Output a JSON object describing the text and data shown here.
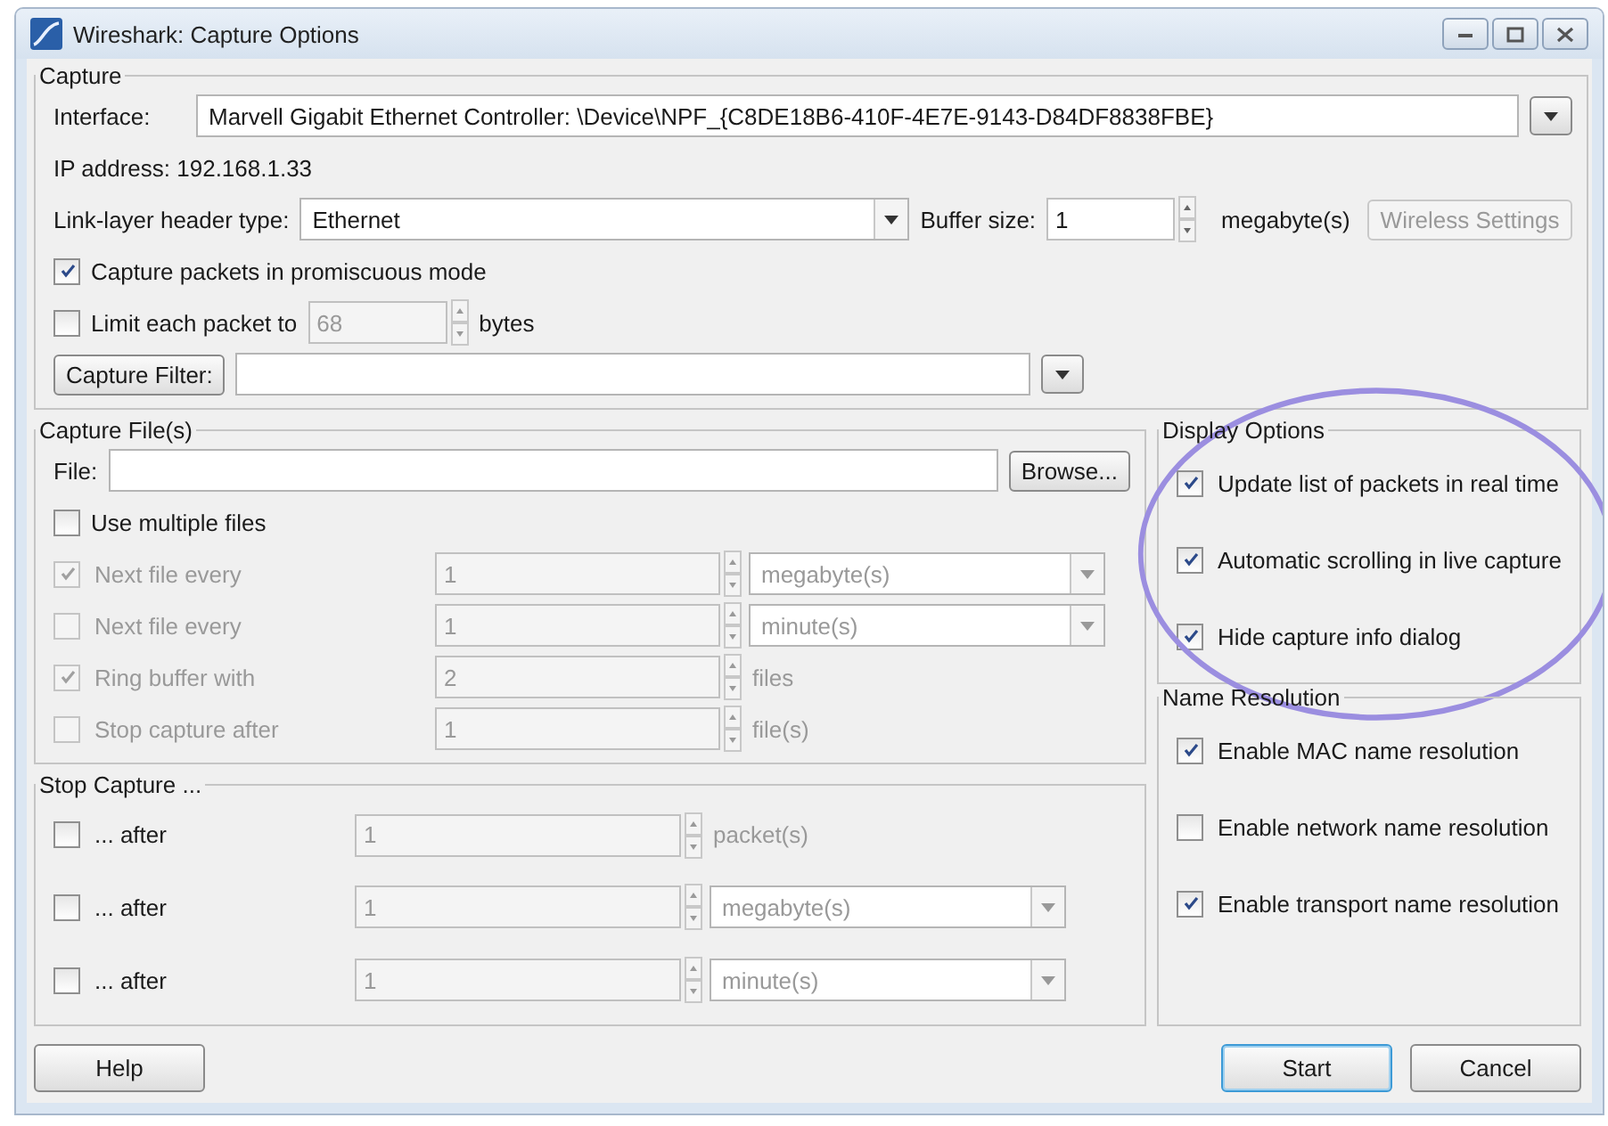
{
  "window": {
    "title": "Wireshark: Capture Options"
  },
  "capture": {
    "title": "Capture",
    "interface": {
      "label": "Interface:",
      "value": "Marvell Gigabit Ethernet Controller: \\Device\\NPF_{C8DE18B6-410F-4E7E-9143-D84DF8838FBE}"
    },
    "ip_address": "IP address: 192.168.1.33",
    "link_layer": {
      "label": "Link-layer header type:",
      "value": "Ethernet"
    },
    "buffer_size": {
      "label": "Buffer size:",
      "value": "1",
      "unit": "megabyte(s)"
    },
    "wireless_button": {
      "label": "Wireless Settings",
      "disabled": true
    },
    "promiscuous": {
      "label": "Capture packets in promiscuous mode",
      "checked": true
    },
    "limit": {
      "label": "Limit each packet to",
      "checked": false,
      "value": "68",
      "unit": "bytes",
      "disabled": true
    },
    "filter": {
      "label": "Capture Filter:"
    }
  },
  "capture_files": {
    "title": "Capture File(s)",
    "file_label": "File:",
    "browse": "Browse...",
    "multiple": {
      "label": "Use multiple files",
      "checked": false
    },
    "rows": [
      {
        "label": "Next file every",
        "checked": true,
        "disabled": true,
        "value": "1",
        "kind": "combo",
        "unit": "megabyte(s)"
      },
      {
        "label": "Next file every",
        "checked": false,
        "disabled": true,
        "value": "1",
        "kind": "combo",
        "unit": "minute(s)"
      },
      {
        "label": "Ring buffer with",
        "checked": true,
        "disabled": true,
        "value": "2",
        "kind": "text",
        "unit": "files"
      },
      {
        "label": "Stop capture after",
        "checked": false,
        "disabled": true,
        "value": "1",
        "kind": "text",
        "unit": "file(s)"
      }
    ]
  },
  "stop_capture": {
    "title": "Stop Capture ...",
    "rows": [
      {
        "label": "... after",
        "checked": false,
        "disabled": false,
        "value": "1",
        "kind": "text",
        "unit": "packet(s)"
      },
      {
        "label": "... after",
        "checked": false,
        "disabled": false,
        "value": "1",
        "kind": "combo",
        "unit": "megabyte(s)"
      },
      {
        "label": "... after",
        "checked": false,
        "disabled": false,
        "value": "1",
        "kind": "combo",
        "unit": "minute(s)"
      }
    ]
  },
  "display_options": {
    "title": "Display Options",
    "highlight": {
      "kind": "ellipse"
    },
    "items": [
      {
        "label": "Update list of packets in real time",
        "checked": true
      },
      {
        "label": "Automatic scrolling in live capture",
        "checked": true
      },
      {
        "label": "Hide capture info dialog",
        "checked": true
      }
    ]
  },
  "name_resolution": {
    "title": "Name Resolution",
    "items": [
      {
        "label": "Enable MAC name resolution",
        "checked": true
      },
      {
        "label": "Enable network name resolution",
        "checked": false
      },
      {
        "label": "Enable transport name resolution",
        "checked": true
      }
    ]
  },
  "buttons": [
    {
      "label": "Help",
      "focused": false
    },
    {
      "label": "Start",
      "focused": true
    },
    {
      "label": "Cancel",
      "focused": false
    }
  ]
}
